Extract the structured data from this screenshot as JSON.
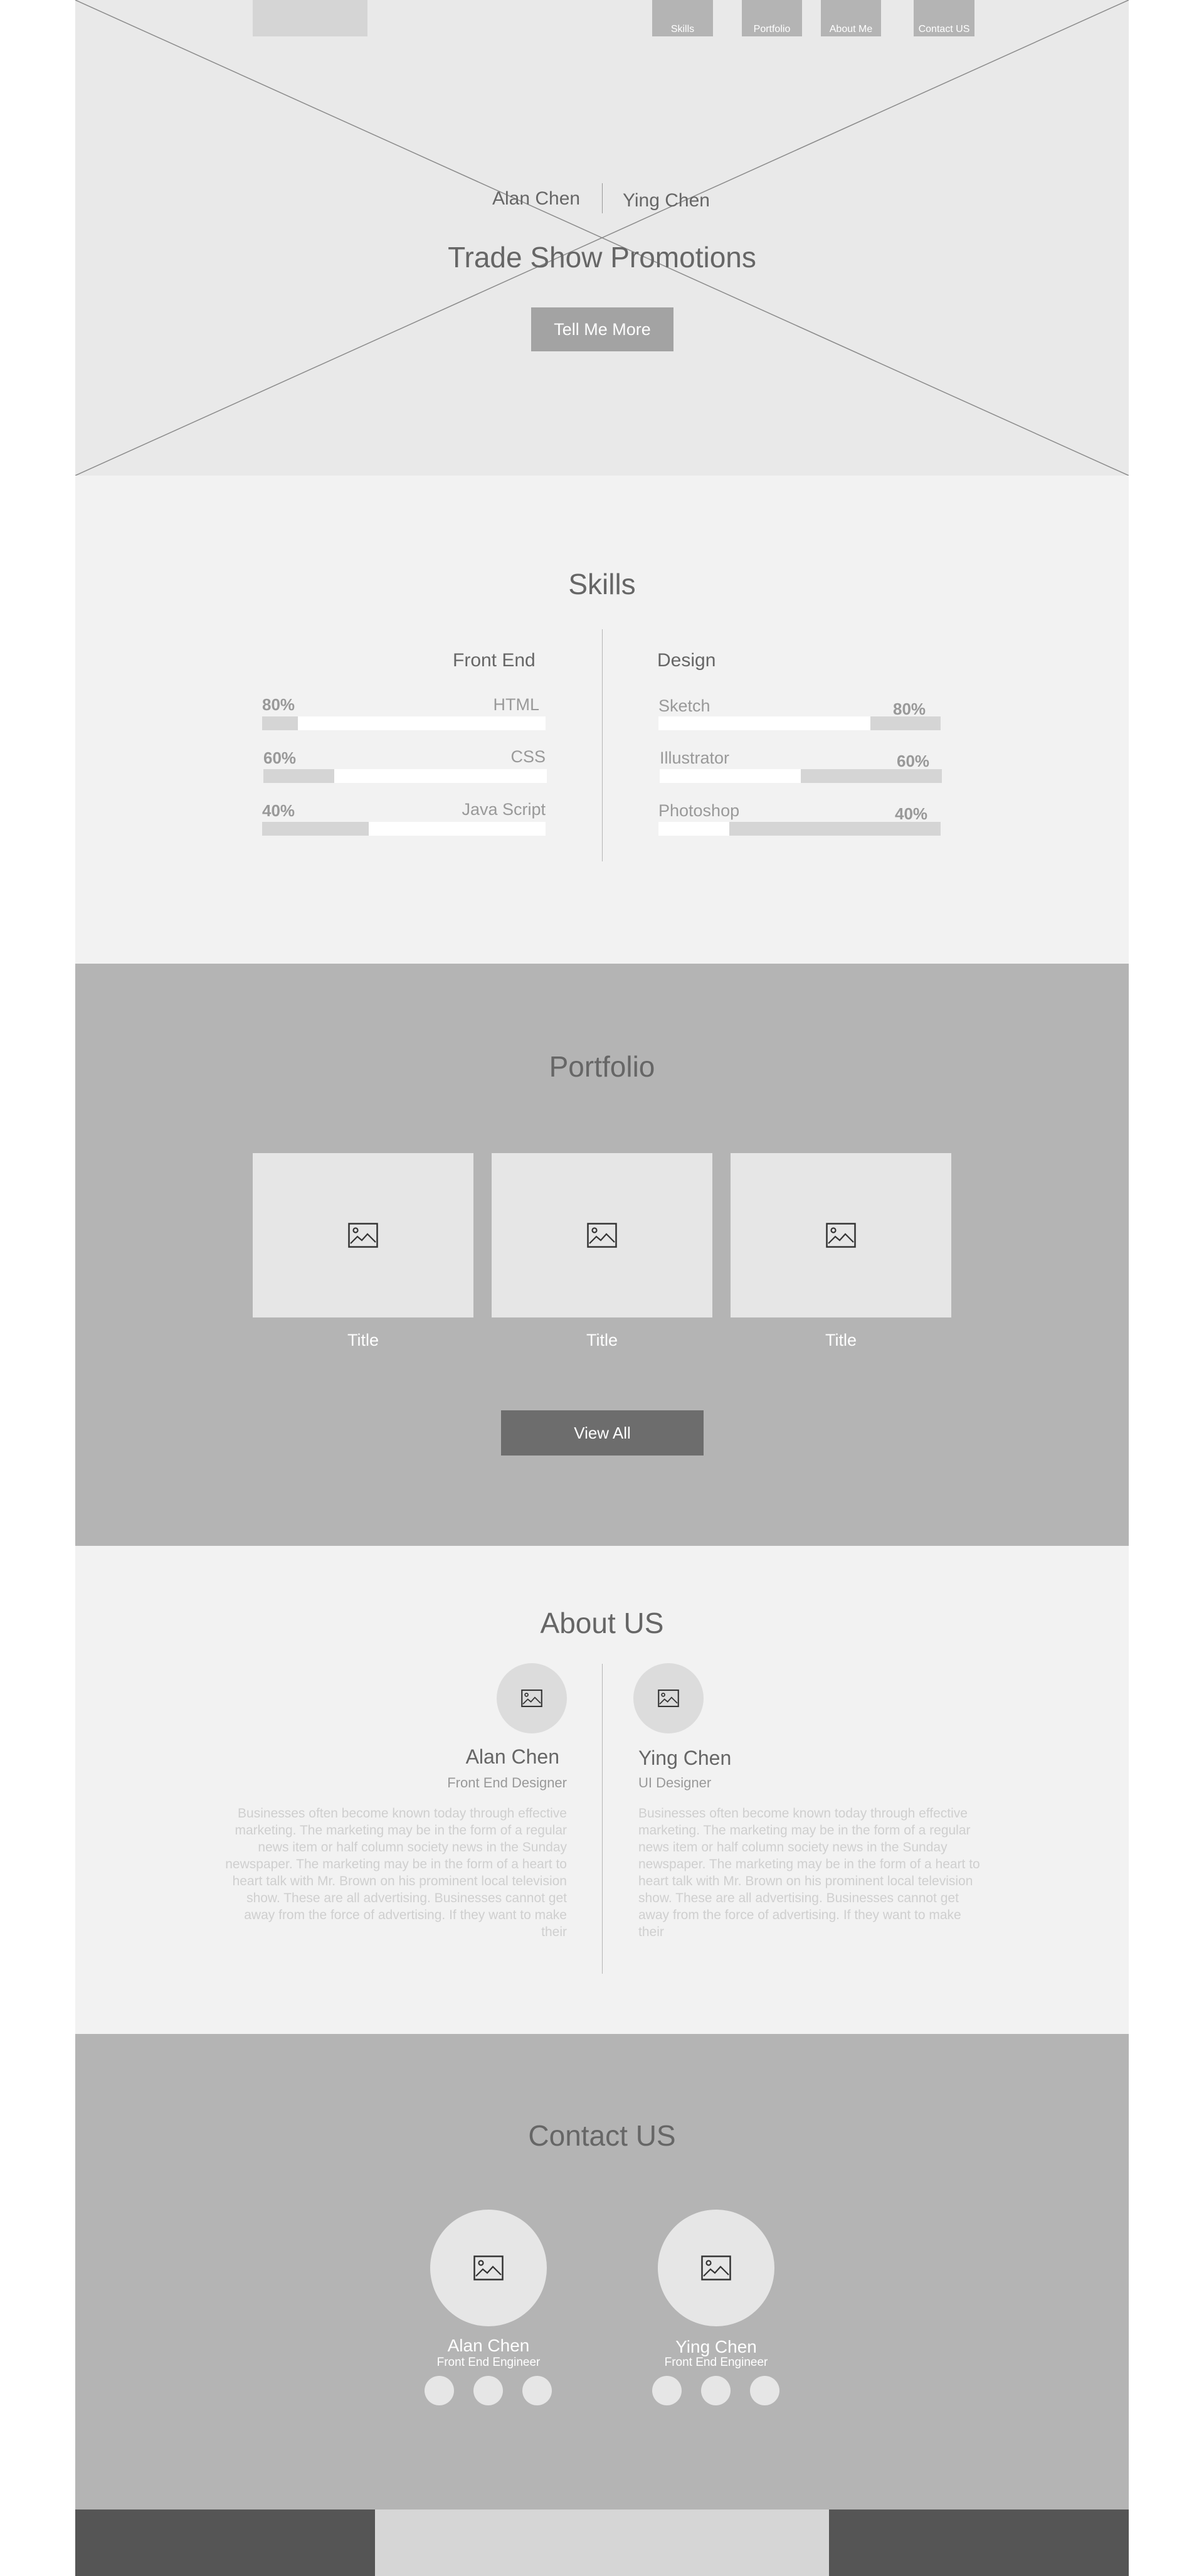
{
  "nav": {
    "items": [
      {
        "label": "Skills"
      },
      {
        "label": "Portfolio"
      },
      {
        "label": "About Me"
      },
      {
        "label": "Contact US"
      }
    ]
  },
  "hero": {
    "name_left": "Alan Chen",
    "name_right": "Ying Chen",
    "title": "Trade Show Promotions",
    "cta": "Tell Me More"
  },
  "skills": {
    "title": "Skills",
    "front_end": {
      "heading": "Front End",
      "items": [
        {
          "name": "HTML",
          "percent_label": "80%",
          "percent": 80
        },
        {
          "name": "CSS",
          "percent_label": "60%",
          "percent": 60
        },
        {
          "name": "Java Script",
          "percent_label": "40%",
          "percent": 40
        }
      ]
    },
    "design": {
      "heading": "Design",
      "items": [
        {
          "name": "Sketch",
          "percent_label": "80%",
          "percent": 80
        },
        {
          "name": "Illustrator",
          "percent_label": "60%",
          "percent": 60
        },
        {
          "name": "Photoshop",
          "percent_label": "40%",
          "percent": 40
        }
      ]
    }
  },
  "portfolio": {
    "title": "Portfolio",
    "cards": [
      {
        "title": "Title",
        "icon": "image-placeholder-icon"
      },
      {
        "title": "Title",
        "icon": "image-placeholder-icon"
      },
      {
        "title": "Title",
        "icon": "image-placeholder-icon"
      }
    ],
    "view_all": "View All"
  },
  "about": {
    "title": "About US",
    "people": [
      {
        "name": "Alan Chen",
        "role": "Front End Designer",
        "bio": "Businesses often become known today through effective marketing. The marketing may be in the form of a regular news item or half column society news in the Sunday newspaper. The marketing may be in the form of a heart to heart talk with Mr. Brown on his prominent local television show. These are all advertising. Businesses cannot get away from the force of advertising. If they want to make their"
      },
      {
        "name": "Ying Chen",
        "role": "UI Designer",
        "bio": "Businesses often become known today through effective marketing. The marketing may be in the form of a regular news item or half column society news in the Sunday newspaper. The marketing may be in the form of a heart to heart talk with Mr. Brown on his prominent local television show. These are all advertising. Businesses cannot get away from the force of advertising. If they want to make their"
      }
    ]
  },
  "contact": {
    "title": "Contact US",
    "people": [
      {
        "name": "Alan Chen",
        "role": "Front End Engineer"
      },
      {
        "name": "Ying Chen",
        "role": "Front End Engineer"
      }
    ]
  },
  "colors": {
    "hero_bg": "#e9e9e9",
    "section_light": "#f2f2f2",
    "section_dark": "#b4b4b4",
    "button_dark": "#6d6d6d",
    "footer": "#555555"
  }
}
